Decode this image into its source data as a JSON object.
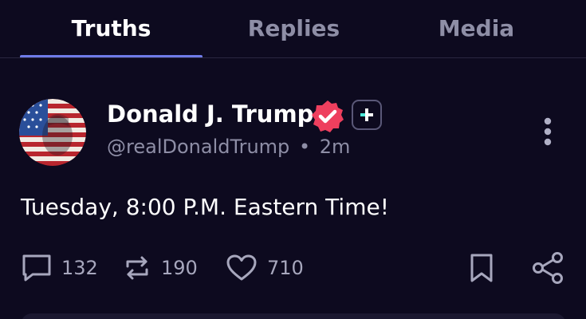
{
  "tabs": [
    {
      "label": "Truths",
      "active": true
    },
    {
      "label": "Replies",
      "active": false
    },
    {
      "label": "Media",
      "active": false
    }
  ],
  "post": {
    "author": {
      "display_name": "Donald J. Trump",
      "handle": "@realDonaldTrump",
      "separator": "•",
      "time_ago": "2m",
      "verified_icon": "verified-check-icon",
      "plus_icon": "truth-plus-icon"
    },
    "text": "Tuesday, 8:00 P.M. Eastern Time!",
    "actions": {
      "replies": "132",
      "retruths": "190",
      "likes": "710"
    }
  },
  "colors": {
    "background": "#0d0a1f",
    "accent_underline": "#6f7be8",
    "verified_badge": "#ee3f5e",
    "plus_accent": "#4de8d8",
    "muted_text": "#8e8ea6"
  }
}
